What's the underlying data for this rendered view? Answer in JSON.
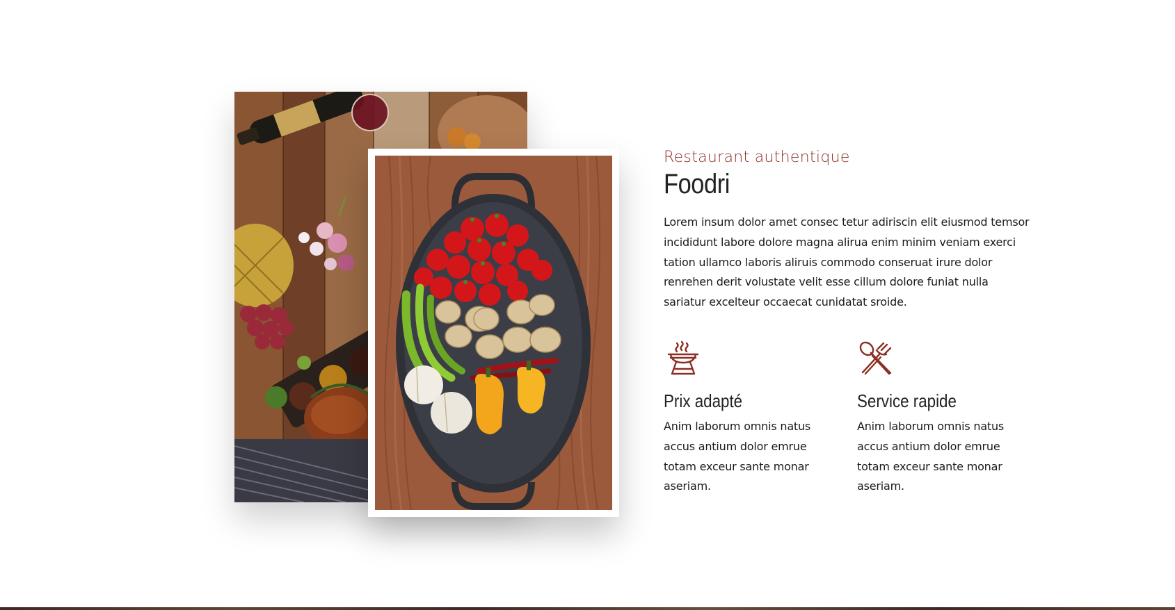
{
  "about": {
    "subtitle": "Restaurant authentique",
    "title": "Foodri",
    "intro": "Lorem insum dolor amet consec tetur adiriscin elit eiusmod temsor incididunt labore dolore magna alirua enim minim veniam exerci tation ullamco laboris aliruis commodo conseruat irure dolor renrehen derit volustate velit esse cillum dolore funiat nulla sariatur excelteur occaecat cunidatat sroide."
  },
  "images": {
    "back": "table-feast-photo",
    "front": "vegetables-pot-photo"
  },
  "features": [
    {
      "icon": "grill-icon",
      "title": "Prix adapté",
      "text": "Anim laborum omnis natus accus antium dolor emrue totam exceur sante monar aseriam."
    },
    {
      "icon": "spoon-fork-icon",
      "title": "Service rapide",
      "text": "Anim laborum omnis natus accus antium dolor emrue totam exceur sante monar aseriam."
    }
  ],
  "colors": {
    "accent": "#8c2f22",
    "heading": "#222222",
    "body_text": "#1a1a1a",
    "background": "#ffffff"
  }
}
